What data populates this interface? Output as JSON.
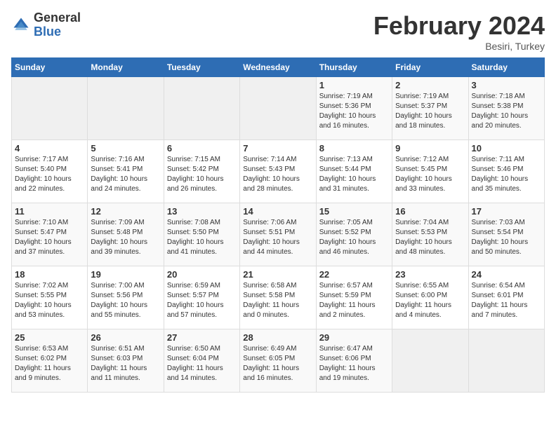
{
  "header": {
    "logo_general": "General",
    "logo_blue": "Blue",
    "title": "February 2024",
    "location": "Besiri, Turkey"
  },
  "weekdays": [
    "Sunday",
    "Monday",
    "Tuesday",
    "Wednesday",
    "Thursday",
    "Friday",
    "Saturday"
  ],
  "weeks": [
    [
      {
        "day": "",
        "info": ""
      },
      {
        "day": "",
        "info": ""
      },
      {
        "day": "",
        "info": ""
      },
      {
        "day": "",
        "info": ""
      },
      {
        "day": "1",
        "info": "Sunrise: 7:19 AM\nSunset: 5:36 PM\nDaylight: 10 hours\nand 16 minutes."
      },
      {
        "day": "2",
        "info": "Sunrise: 7:19 AM\nSunset: 5:37 PM\nDaylight: 10 hours\nand 18 minutes."
      },
      {
        "day": "3",
        "info": "Sunrise: 7:18 AM\nSunset: 5:38 PM\nDaylight: 10 hours\nand 20 minutes."
      }
    ],
    [
      {
        "day": "4",
        "info": "Sunrise: 7:17 AM\nSunset: 5:40 PM\nDaylight: 10 hours\nand 22 minutes."
      },
      {
        "day": "5",
        "info": "Sunrise: 7:16 AM\nSunset: 5:41 PM\nDaylight: 10 hours\nand 24 minutes."
      },
      {
        "day": "6",
        "info": "Sunrise: 7:15 AM\nSunset: 5:42 PM\nDaylight: 10 hours\nand 26 minutes."
      },
      {
        "day": "7",
        "info": "Sunrise: 7:14 AM\nSunset: 5:43 PM\nDaylight: 10 hours\nand 28 minutes."
      },
      {
        "day": "8",
        "info": "Sunrise: 7:13 AM\nSunset: 5:44 PM\nDaylight: 10 hours\nand 31 minutes."
      },
      {
        "day": "9",
        "info": "Sunrise: 7:12 AM\nSunset: 5:45 PM\nDaylight: 10 hours\nand 33 minutes."
      },
      {
        "day": "10",
        "info": "Sunrise: 7:11 AM\nSunset: 5:46 PM\nDaylight: 10 hours\nand 35 minutes."
      }
    ],
    [
      {
        "day": "11",
        "info": "Sunrise: 7:10 AM\nSunset: 5:47 PM\nDaylight: 10 hours\nand 37 minutes."
      },
      {
        "day": "12",
        "info": "Sunrise: 7:09 AM\nSunset: 5:48 PM\nDaylight: 10 hours\nand 39 minutes."
      },
      {
        "day": "13",
        "info": "Sunrise: 7:08 AM\nSunset: 5:50 PM\nDaylight: 10 hours\nand 41 minutes."
      },
      {
        "day": "14",
        "info": "Sunrise: 7:06 AM\nSunset: 5:51 PM\nDaylight: 10 hours\nand 44 minutes."
      },
      {
        "day": "15",
        "info": "Sunrise: 7:05 AM\nSunset: 5:52 PM\nDaylight: 10 hours\nand 46 minutes."
      },
      {
        "day": "16",
        "info": "Sunrise: 7:04 AM\nSunset: 5:53 PM\nDaylight: 10 hours\nand 48 minutes."
      },
      {
        "day": "17",
        "info": "Sunrise: 7:03 AM\nSunset: 5:54 PM\nDaylight: 10 hours\nand 50 minutes."
      }
    ],
    [
      {
        "day": "18",
        "info": "Sunrise: 7:02 AM\nSunset: 5:55 PM\nDaylight: 10 hours\nand 53 minutes."
      },
      {
        "day": "19",
        "info": "Sunrise: 7:00 AM\nSunset: 5:56 PM\nDaylight: 10 hours\nand 55 minutes."
      },
      {
        "day": "20",
        "info": "Sunrise: 6:59 AM\nSunset: 5:57 PM\nDaylight: 10 hours\nand 57 minutes."
      },
      {
        "day": "21",
        "info": "Sunrise: 6:58 AM\nSunset: 5:58 PM\nDaylight: 11 hours\nand 0 minutes."
      },
      {
        "day": "22",
        "info": "Sunrise: 6:57 AM\nSunset: 5:59 PM\nDaylight: 11 hours\nand 2 minutes."
      },
      {
        "day": "23",
        "info": "Sunrise: 6:55 AM\nSunset: 6:00 PM\nDaylight: 11 hours\nand 4 minutes."
      },
      {
        "day": "24",
        "info": "Sunrise: 6:54 AM\nSunset: 6:01 PM\nDaylight: 11 hours\nand 7 minutes."
      }
    ],
    [
      {
        "day": "25",
        "info": "Sunrise: 6:53 AM\nSunset: 6:02 PM\nDaylight: 11 hours\nand 9 minutes."
      },
      {
        "day": "26",
        "info": "Sunrise: 6:51 AM\nSunset: 6:03 PM\nDaylight: 11 hours\nand 11 minutes."
      },
      {
        "day": "27",
        "info": "Sunrise: 6:50 AM\nSunset: 6:04 PM\nDaylight: 11 hours\nand 14 minutes."
      },
      {
        "day": "28",
        "info": "Sunrise: 6:49 AM\nSunset: 6:05 PM\nDaylight: 11 hours\nand 16 minutes."
      },
      {
        "day": "29",
        "info": "Sunrise: 6:47 AM\nSunset: 6:06 PM\nDaylight: 11 hours\nand 19 minutes."
      },
      {
        "day": "",
        "info": ""
      },
      {
        "day": "",
        "info": ""
      }
    ]
  ]
}
